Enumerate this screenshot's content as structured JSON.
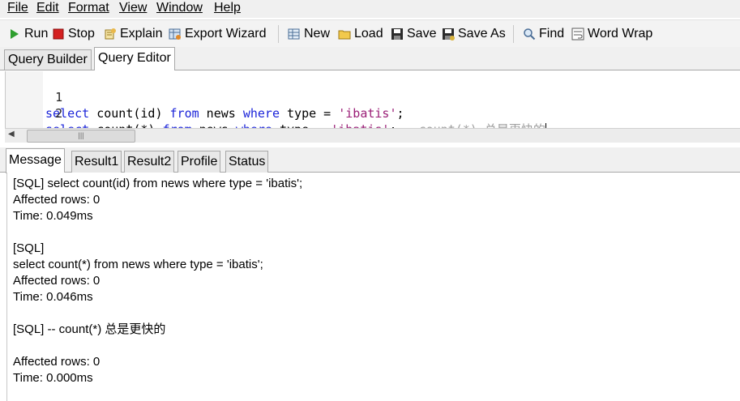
{
  "menu": [
    "File",
    "Edit",
    "Format",
    "View",
    "Window",
    "Help"
  ],
  "toolbar": {
    "run": "Run",
    "stop": "Stop",
    "explain": "Explain",
    "export_wizard": "Export Wizard",
    "new": "New",
    "load": "Load",
    "save": "Save",
    "save_as": "Save As",
    "find": "Find",
    "word_wrap": "Word Wrap"
  },
  "query_tabs": [
    "Query Builder",
    "Query Editor"
  ],
  "editor": {
    "line1": {
      "num": "1",
      "kw1": "select",
      "t1": " count(id) ",
      "kw2": "from",
      "t2": " news ",
      "kw3": "where",
      "t3": " type = ",
      "str": "'ibatis'",
      "t4": ";"
    },
    "line2": {
      "num": "2",
      "kw1": "select",
      "t1": " count(*) ",
      "kw2": "from",
      "t2": " news ",
      "kw3": "where",
      "t3": " type = ",
      "str": "'ibatis'",
      "t4": ";",
      "comment": "-- count(*) 总是更快的"
    }
  },
  "result_tabs": [
    "Message",
    "Result1",
    "Result2",
    "Profile",
    "Status"
  ],
  "messages": [
    "[SQL] select count(id) from news where type = 'ibatis';",
    "Affected rows: 0",
    "Time: 0.049ms",
    "",
    "[SQL]",
    "select count(*) from news where type = 'ibatis';",
    "Affected rows: 0",
    "Time: 0.046ms",
    "",
    "[SQL] -- count(*) 总是更快的",
    "",
    "Affected rows: 0",
    "Time: 0.000ms"
  ],
  "colors": {
    "keyword": "#1b24d9",
    "string": "#9a1d76",
    "comment": "#9e9e9e",
    "run_icon": "#2e9e2e",
    "stop_icon": "#d42020"
  }
}
